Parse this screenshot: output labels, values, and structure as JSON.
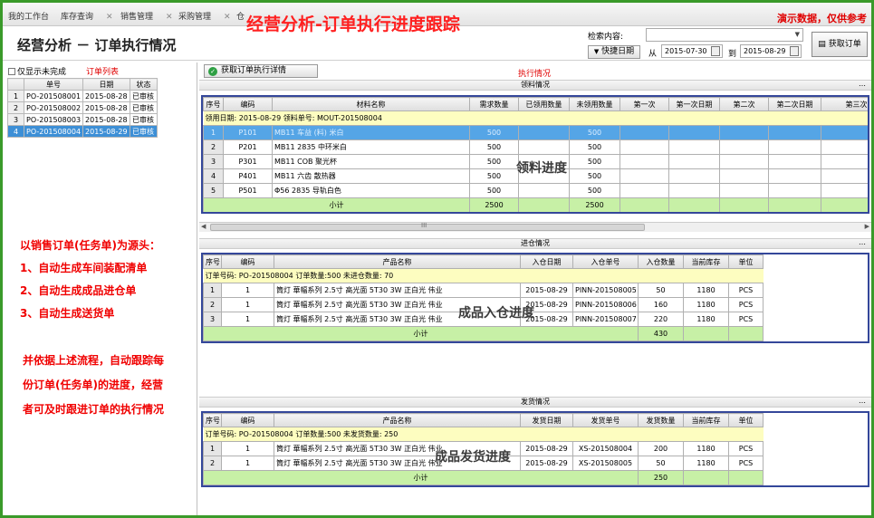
{
  "tabs": [
    {
      "label": "我的工作台",
      "closable": false
    },
    {
      "label": "库存查询",
      "closable": true
    },
    {
      "label": "销售管理",
      "closable": true
    },
    {
      "label": "采购管理",
      "closable": true
    },
    {
      "label": "仓",
      "closable": false
    }
  ],
  "banner_title": "经营分析-订单执行进度跟踪",
  "demo_note": "演示数据，仅供参考",
  "page_title": "经营分析 － 订单执行情况",
  "search": {
    "label": "检索内容:",
    "value": ""
  },
  "quick_date_label": "快捷日期",
  "date_from_label": "从",
  "date_from": "2015-07-30",
  "date_to_label": "到",
  "date_to": "2015-08-29",
  "fetch_orders_label": "获取订单",
  "only_unfinished_label": "仅显示未完成",
  "order_list_title": "订单列表",
  "order_list": {
    "columns": [
      "单号",
      "日期",
      "状态"
    ],
    "rows": [
      {
        "n": "1",
        "no": "PO-201508001",
        "date": "2015-08-28",
        "status": "已审核"
      },
      {
        "n": "2",
        "no": "PO-201508002",
        "date": "2015-08-28",
        "status": "已审核"
      },
      {
        "n": "3",
        "no": "PO-201508003",
        "date": "2015-08-28",
        "status": "已审核"
      },
      {
        "n": "4",
        "no": "PO-201508004",
        "date": "2015-08-29",
        "status": "已审核"
      }
    ]
  },
  "notes": [
    "以销售订单(任务单)为源头：",
    "1、自动生成车间装配清单",
    "2、自动生成成品进仓单",
    "3、自动生成送货单",
    "并依据上述流程，自动跟踪每",
    "份订单(任务单)的进度，经营",
    "者可及时跟进订单的执行情况"
  ],
  "detail_button_label": "获取订单执行详情",
  "exec_label": "执行情况",
  "material": {
    "title": "领料情况",
    "overlay": "领料进度",
    "columns": [
      "序号",
      "编码",
      "材料名称",
      "需求数量",
      "已领用数量",
      "未领用数量",
      "第一次",
      "第一次日期",
      "第二次",
      "第二次日期",
      "第三次"
    ],
    "group": "领用日期: 2015-08-29   领料单号: MOUT-201508004",
    "rows": [
      {
        "n": "1",
        "code": "P101",
        "name": "MB11 车益 (料) 米白",
        "need": "500",
        "used": "",
        "unused": "500"
      },
      {
        "n": "2",
        "code": "P201",
        "name": "MB11 2835 中环米白",
        "need": "500",
        "used": "",
        "unused": "500"
      },
      {
        "n": "3",
        "code": "P301",
        "name": "MB11 COB 聚光杯",
        "need": "500",
        "used": "",
        "unused": "500"
      },
      {
        "n": "4",
        "code": "P401",
        "name": "MB11 六齿 散热器",
        "need": "500",
        "used": "",
        "unused": "500"
      },
      {
        "n": "5",
        "code": "P501",
        "name": "Φ56 2835 导轨白色",
        "need": "500",
        "used": "",
        "unused": "500"
      }
    ],
    "subtotal_label": "小计",
    "subtotal_need": "2500",
    "subtotal_unused": "2500"
  },
  "scroll_grip": "III",
  "warehouse": {
    "title": "进仓情况",
    "overlay": "成品入仓进度",
    "columns": [
      "序号",
      "编码",
      "产品名称",
      "入仓日期",
      "入仓单号",
      "入仓数量",
      "当前库存",
      "单位"
    ],
    "group": "订单号码: PO-201508004        订单数量:500       未进仓数量: 70",
    "rows": [
      {
        "n": "1",
        "code": "1",
        "name": "筒灯 華幅系列 2.5寸 高光面 5T30 3W 正白光 伟业",
        "date": "2015-08-29",
        "doc": "PINN-201508005",
        "qty": "50",
        "stock": "1180",
        "unit": "PCS"
      },
      {
        "n": "2",
        "code": "1",
        "name": "筒灯 華幅系列 2.5寸 高光面 5T30 3W 正白光 伟业",
        "date": "2015-08-29",
        "doc": "PINN-201508006",
        "qty": "160",
        "stock": "1180",
        "unit": "PCS"
      },
      {
        "n": "3",
        "code": "1",
        "name": "筒灯 華幅系列 2.5寸 高光面 5T30 3W 正白光 伟业",
        "date": "2015-08-29",
        "doc": "PINN-201508007",
        "qty": "220",
        "stock": "1180",
        "unit": "PCS"
      }
    ],
    "subtotal_label": "小计",
    "subtotal_qty": "430"
  },
  "delivery": {
    "title": "发货情况",
    "overlay": "成品发货进度",
    "columns": [
      "序号",
      "编码",
      "产品名称",
      "发货日期",
      "发货单号",
      "发货数量",
      "当前库存",
      "单位"
    ],
    "group": "订单号码: PO-201508004        订单数量:500       未发货数量: 250",
    "rows": [
      {
        "n": "1",
        "code": "1",
        "name": "筒灯 華幅系列 2.5寸 高光面 5T30 3W 正白光 伟业",
        "date": "2015-08-29",
        "doc": "XS-201508004",
        "qty": "200",
        "stock": "1180",
        "unit": "PCS"
      },
      {
        "n": "2",
        "code": "1",
        "name": "筒灯 華幅系列 2.5寸 高光面 5T30 3W 正白光 伟业",
        "date": "2015-08-29",
        "doc": "XS-201508005",
        "qty": "50",
        "stock": "1180",
        "unit": "PCS"
      }
    ],
    "subtotal_label": "小计",
    "subtotal_qty": "250"
  },
  "colors": {
    "frame": "#3a9a2a",
    "highlight_box": "#34479a",
    "annotation_red": "#f00000",
    "selected_row": "#3d8fd6"
  }
}
